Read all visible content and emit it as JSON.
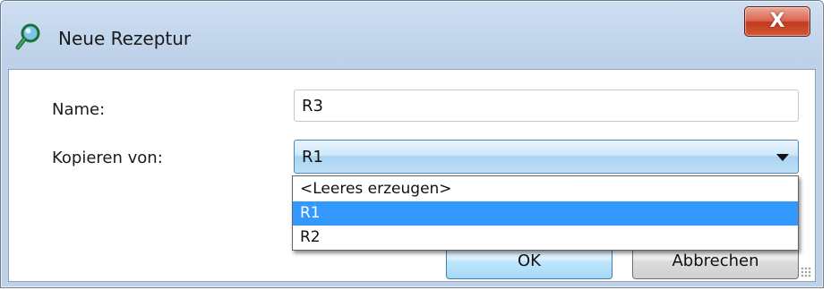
{
  "window": {
    "title": "Neue Rezeptur",
    "close_label": "X",
    "app_icon": "magnifier-icon"
  },
  "form": {
    "name_label": "Name:",
    "name_value": "R3",
    "copy_label": "Kopieren von:",
    "copy_selected": "R1",
    "copy_options": [
      "<Leeres erzeugen>",
      "R1",
      "R2"
    ],
    "highlighted_option": "R1"
  },
  "buttons": {
    "ok_label": "OK",
    "cancel_label": "Abbrechen"
  },
  "colors": {
    "selection": "#3399ff",
    "close_button": "#c2391e",
    "titlebar": "#c3d6ec"
  }
}
